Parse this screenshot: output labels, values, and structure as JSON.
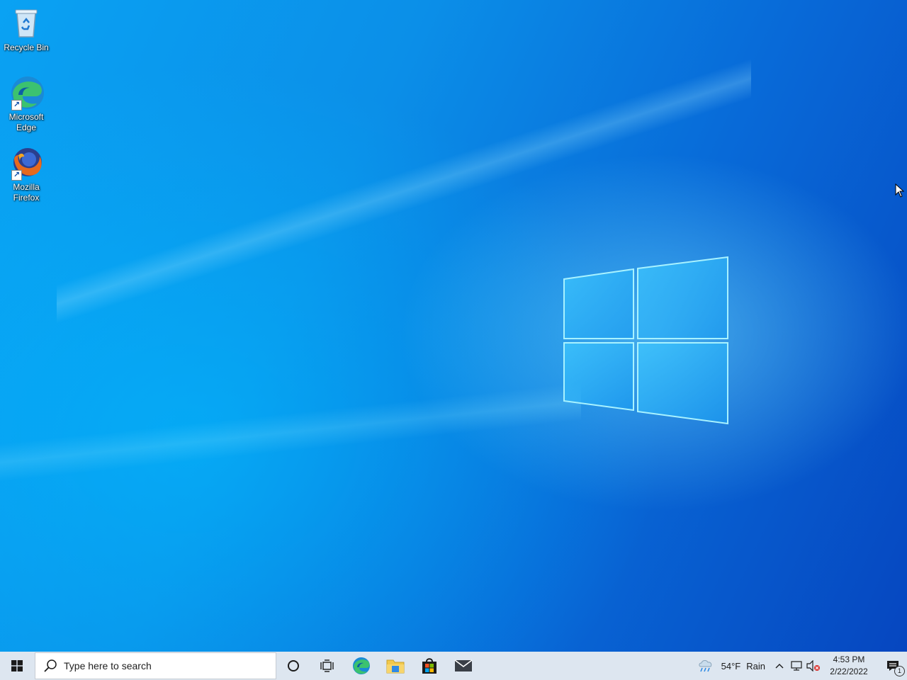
{
  "desktop": {
    "icons": [
      {
        "label": "Recycle Bin"
      },
      {
        "label": "Microsoft Edge"
      },
      {
        "label": "Mozilla Firefox"
      }
    ]
  },
  "taskbar": {
    "search_placeholder": "Type here to search",
    "pinned": [
      "cortana-icon",
      "task-view-icon",
      "edge-icon",
      "file-explorer-icon",
      "store-icon",
      "mail-icon"
    ],
    "weather": {
      "temp": "54°F",
      "condition": "Rain"
    },
    "clock": {
      "time": "4:53 PM",
      "date": "2/22/2022"
    },
    "notification_count": "1"
  },
  "colors": {
    "taskbar_bg": "#dde6f0",
    "wallpaper_accent": "#0a8ff0"
  }
}
